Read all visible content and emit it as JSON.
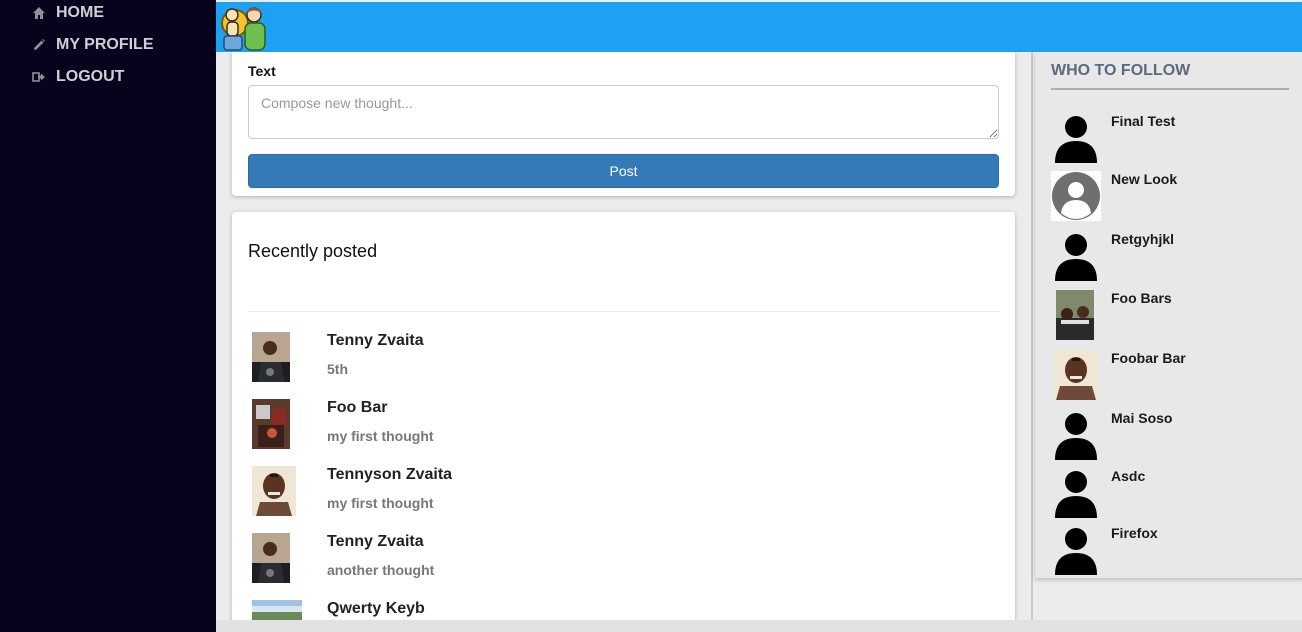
{
  "sidebar": {
    "items": [
      {
        "label": "HOME",
        "icon": "home-icon"
      },
      {
        "label": "MY PROFILE",
        "icon": "pencil-icon"
      },
      {
        "label": "LOGOUT",
        "icon": "logout-icon"
      }
    ]
  },
  "header": {
    "logo_icon": "people-logo-icon",
    "color": "#1da1f2"
  },
  "compose": {
    "label": "Text",
    "placeholder": "Compose new thought...",
    "post_label": "Post"
  },
  "feed": {
    "title": "Recently posted",
    "posts": [
      {
        "author": "Tenny Zvaita",
        "text": "5th"
      },
      {
        "author": "Foo Bar",
        "text": "my first thought"
      },
      {
        "author": "Tennyson Zvaita",
        "text": "my first thought"
      },
      {
        "author": "Tenny Zvaita",
        "text": "another thought"
      },
      {
        "author": "Qwerty Keyb",
        "text": ""
      }
    ]
  },
  "follow": {
    "heading": "WHO TO FOLLOW",
    "users": [
      {
        "name": "Final Test",
        "avatar": "silhouette"
      },
      {
        "name": "New Look",
        "avatar": "default-gray"
      },
      {
        "name": "Retgyhjkl",
        "avatar": "silhouette"
      },
      {
        "name": "Foo Bars",
        "avatar": "photo"
      },
      {
        "name": "Foobar Bar",
        "avatar": "photo"
      },
      {
        "name": "Mai Soso",
        "avatar": "silhouette"
      },
      {
        "name": "Asdc",
        "avatar": "silhouette"
      },
      {
        "name": "Firefox",
        "avatar": "silhouette"
      }
    ]
  },
  "colors": {
    "sidebar": "#09021d",
    "accent": "#1da1f2",
    "button": "#337ab7"
  }
}
